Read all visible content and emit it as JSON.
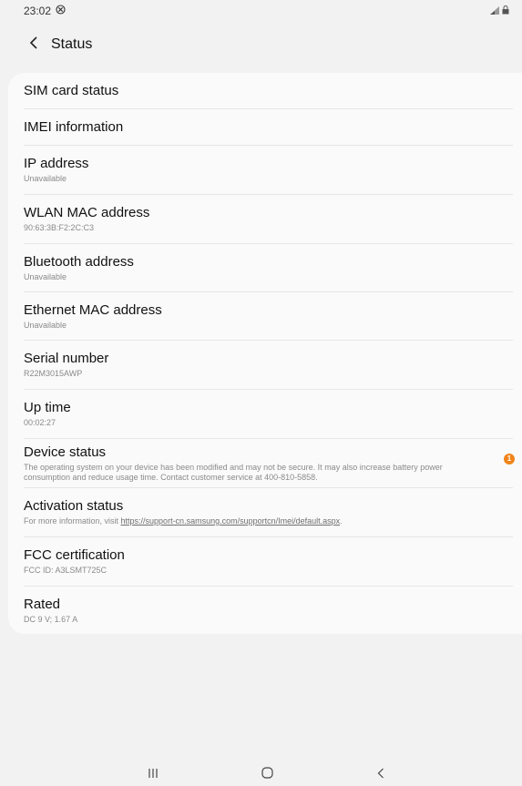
{
  "status_bar": {
    "time": "23:02",
    "left_icon": "blocked-notification-icon",
    "right_icons": [
      "signal-icon",
      "lock-icon"
    ]
  },
  "app_bar": {
    "title": "Status",
    "back_icon": "chevron-left-icon"
  },
  "items": [
    {
      "title": "SIM card status",
      "subtitle": ""
    },
    {
      "title": "IMEI information",
      "subtitle": ""
    },
    {
      "title": "IP address",
      "subtitle": "Unavailable"
    },
    {
      "title": "WLAN MAC address",
      "subtitle": "90:63:3B:F2:2C:C3"
    },
    {
      "title": "Bluetooth address",
      "subtitle": "Unavailable"
    },
    {
      "title": "Ethernet MAC address",
      "subtitle": "Unavailable"
    },
    {
      "title": "Serial number",
      "subtitle": "R22M3015AWP"
    },
    {
      "title": "Up time",
      "subtitle": "00:02:27"
    },
    {
      "title": "Device status",
      "subtitle": "The operating system on your device has been modified and may not be secure. It may also increase battery power consumption and reduce usage time. Contact customer service at 400-810-5858.",
      "badge": "1"
    },
    {
      "title": "Activation status",
      "subtitle_prefix": "For more information, visit ",
      "subtitle_link": "https://support-cn.samsung.com/supportcn/Imei/default.aspx",
      "subtitle_suffix": "."
    },
    {
      "title": "FCC certification",
      "subtitle": "FCC ID: A3LSMT725C"
    },
    {
      "title": "Rated",
      "subtitle": "DC 9 V; 1.67 A"
    }
  ],
  "nav_bar": {
    "recents_icon": "recents-icon",
    "home_icon": "home-icon",
    "back_icon": "back-icon"
  },
  "colors": {
    "background": "#f2f2f2",
    "card": "#fafafa",
    "badge": "#f08419"
  }
}
